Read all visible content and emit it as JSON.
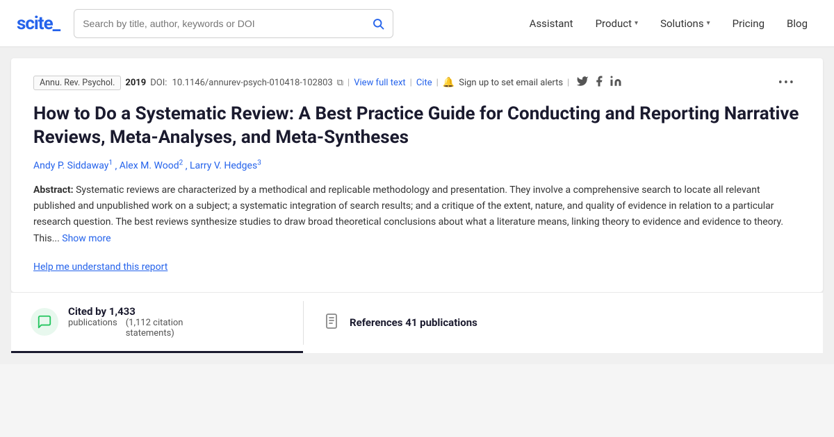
{
  "navbar": {
    "logo_text": "scite_",
    "search_placeholder": "Search by title, author, keywords or DOI",
    "nav_items": [
      {
        "label": "Assistant",
        "has_chevron": false
      },
      {
        "label": "Product",
        "has_chevron": true
      },
      {
        "label": "Solutions",
        "has_chevron": true
      },
      {
        "label": "Pricing",
        "has_chevron": false
      },
      {
        "label": "Blog",
        "has_chevron": false
      }
    ]
  },
  "paper": {
    "journal": "Annu. Rev. Psychol.",
    "year": "2019",
    "doi_label": "DOI:",
    "doi_value": "10.1146/annurev-psych-010418-102803",
    "view_full_text": "View full text",
    "cite": "Cite",
    "alert_text": "Sign up to set email alerts",
    "title": "How to Do a Systematic Review: A Best Practice Guide for Conducting and Reporting Narrative Reviews, Meta-Analyses, and Meta-Syntheses",
    "authors": [
      {
        "name": "Andy P. Siddaway",
        "sup": "1"
      },
      {
        "name": "Alex M. Wood",
        "sup": "2"
      },
      {
        "name": "Larry V. Hedges",
        "sup": "3"
      }
    ],
    "abstract_label": "Abstract:",
    "abstract_text": "Systematic reviews are characterized by a methodical and replicable methodology and presentation. They involve a comprehensive search to locate all relevant published and unpublished work on a subject; a systematic integration of search results; and a critique of the extent, nature, and quality of evidence in relation to a particular research question. The best reviews synthesize studies to draw broad theoretical conclusions about what a literature means, linking theory to evidence and evidence to theory. This...",
    "show_more": "Show more",
    "help_link": "Help me understand this report"
  },
  "stats": {
    "cited_by_label": "Cited by 1,433",
    "cited_by_sub": "publications",
    "citation_count": "(1,112 citation",
    "citation_count2": "statements)",
    "refs_label": "References 41 publications"
  }
}
